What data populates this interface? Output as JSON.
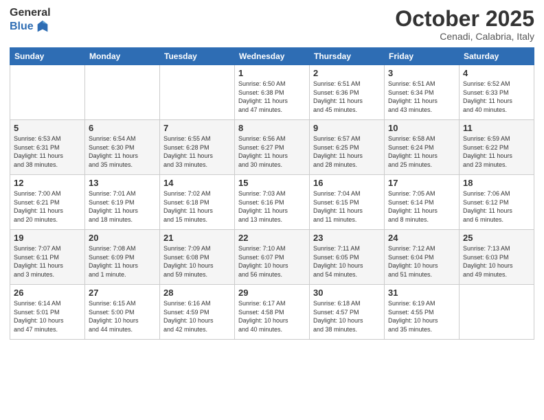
{
  "logo": {
    "general": "General",
    "blue": "Blue"
  },
  "title": "October 2025",
  "subtitle": "Cenadi, Calabria, Italy",
  "days_of_week": [
    "Sunday",
    "Monday",
    "Tuesday",
    "Wednesday",
    "Thursday",
    "Friday",
    "Saturday"
  ],
  "weeks": [
    [
      {
        "day": "",
        "info": ""
      },
      {
        "day": "",
        "info": ""
      },
      {
        "day": "",
        "info": ""
      },
      {
        "day": "1",
        "info": "Sunrise: 6:50 AM\nSunset: 6:38 PM\nDaylight: 11 hours\nand 47 minutes."
      },
      {
        "day": "2",
        "info": "Sunrise: 6:51 AM\nSunset: 6:36 PM\nDaylight: 11 hours\nand 45 minutes."
      },
      {
        "day": "3",
        "info": "Sunrise: 6:51 AM\nSunset: 6:34 PM\nDaylight: 11 hours\nand 43 minutes."
      },
      {
        "day": "4",
        "info": "Sunrise: 6:52 AM\nSunset: 6:33 PM\nDaylight: 11 hours\nand 40 minutes."
      }
    ],
    [
      {
        "day": "5",
        "info": "Sunrise: 6:53 AM\nSunset: 6:31 PM\nDaylight: 11 hours\nand 38 minutes."
      },
      {
        "day": "6",
        "info": "Sunrise: 6:54 AM\nSunset: 6:30 PM\nDaylight: 11 hours\nand 35 minutes."
      },
      {
        "day": "7",
        "info": "Sunrise: 6:55 AM\nSunset: 6:28 PM\nDaylight: 11 hours\nand 33 minutes."
      },
      {
        "day": "8",
        "info": "Sunrise: 6:56 AM\nSunset: 6:27 PM\nDaylight: 11 hours\nand 30 minutes."
      },
      {
        "day": "9",
        "info": "Sunrise: 6:57 AM\nSunset: 6:25 PM\nDaylight: 11 hours\nand 28 minutes."
      },
      {
        "day": "10",
        "info": "Sunrise: 6:58 AM\nSunset: 6:24 PM\nDaylight: 11 hours\nand 25 minutes."
      },
      {
        "day": "11",
        "info": "Sunrise: 6:59 AM\nSunset: 6:22 PM\nDaylight: 11 hours\nand 23 minutes."
      }
    ],
    [
      {
        "day": "12",
        "info": "Sunrise: 7:00 AM\nSunset: 6:21 PM\nDaylight: 11 hours\nand 20 minutes."
      },
      {
        "day": "13",
        "info": "Sunrise: 7:01 AM\nSunset: 6:19 PM\nDaylight: 11 hours\nand 18 minutes."
      },
      {
        "day": "14",
        "info": "Sunrise: 7:02 AM\nSunset: 6:18 PM\nDaylight: 11 hours\nand 15 minutes."
      },
      {
        "day": "15",
        "info": "Sunrise: 7:03 AM\nSunset: 6:16 PM\nDaylight: 11 hours\nand 13 minutes."
      },
      {
        "day": "16",
        "info": "Sunrise: 7:04 AM\nSunset: 6:15 PM\nDaylight: 11 hours\nand 11 minutes."
      },
      {
        "day": "17",
        "info": "Sunrise: 7:05 AM\nSunset: 6:14 PM\nDaylight: 11 hours\nand 8 minutes."
      },
      {
        "day": "18",
        "info": "Sunrise: 7:06 AM\nSunset: 6:12 PM\nDaylight: 11 hours\nand 6 minutes."
      }
    ],
    [
      {
        "day": "19",
        "info": "Sunrise: 7:07 AM\nSunset: 6:11 PM\nDaylight: 11 hours\nand 3 minutes."
      },
      {
        "day": "20",
        "info": "Sunrise: 7:08 AM\nSunset: 6:09 PM\nDaylight: 11 hours\nand 1 minute."
      },
      {
        "day": "21",
        "info": "Sunrise: 7:09 AM\nSunset: 6:08 PM\nDaylight: 10 hours\nand 59 minutes."
      },
      {
        "day": "22",
        "info": "Sunrise: 7:10 AM\nSunset: 6:07 PM\nDaylight: 10 hours\nand 56 minutes."
      },
      {
        "day": "23",
        "info": "Sunrise: 7:11 AM\nSunset: 6:05 PM\nDaylight: 10 hours\nand 54 minutes."
      },
      {
        "day": "24",
        "info": "Sunrise: 7:12 AM\nSunset: 6:04 PM\nDaylight: 10 hours\nand 51 minutes."
      },
      {
        "day": "25",
        "info": "Sunrise: 7:13 AM\nSunset: 6:03 PM\nDaylight: 10 hours\nand 49 minutes."
      }
    ],
    [
      {
        "day": "26",
        "info": "Sunrise: 6:14 AM\nSunset: 5:01 PM\nDaylight: 10 hours\nand 47 minutes."
      },
      {
        "day": "27",
        "info": "Sunrise: 6:15 AM\nSunset: 5:00 PM\nDaylight: 10 hours\nand 44 minutes."
      },
      {
        "day": "28",
        "info": "Sunrise: 6:16 AM\nSunset: 4:59 PM\nDaylight: 10 hours\nand 42 minutes."
      },
      {
        "day": "29",
        "info": "Sunrise: 6:17 AM\nSunset: 4:58 PM\nDaylight: 10 hours\nand 40 minutes."
      },
      {
        "day": "30",
        "info": "Sunrise: 6:18 AM\nSunset: 4:57 PM\nDaylight: 10 hours\nand 38 minutes."
      },
      {
        "day": "31",
        "info": "Sunrise: 6:19 AM\nSunset: 4:55 PM\nDaylight: 10 hours\nand 35 minutes."
      },
      {
        "day": "",
        "info": ""
      }
    ]
  ]
}
